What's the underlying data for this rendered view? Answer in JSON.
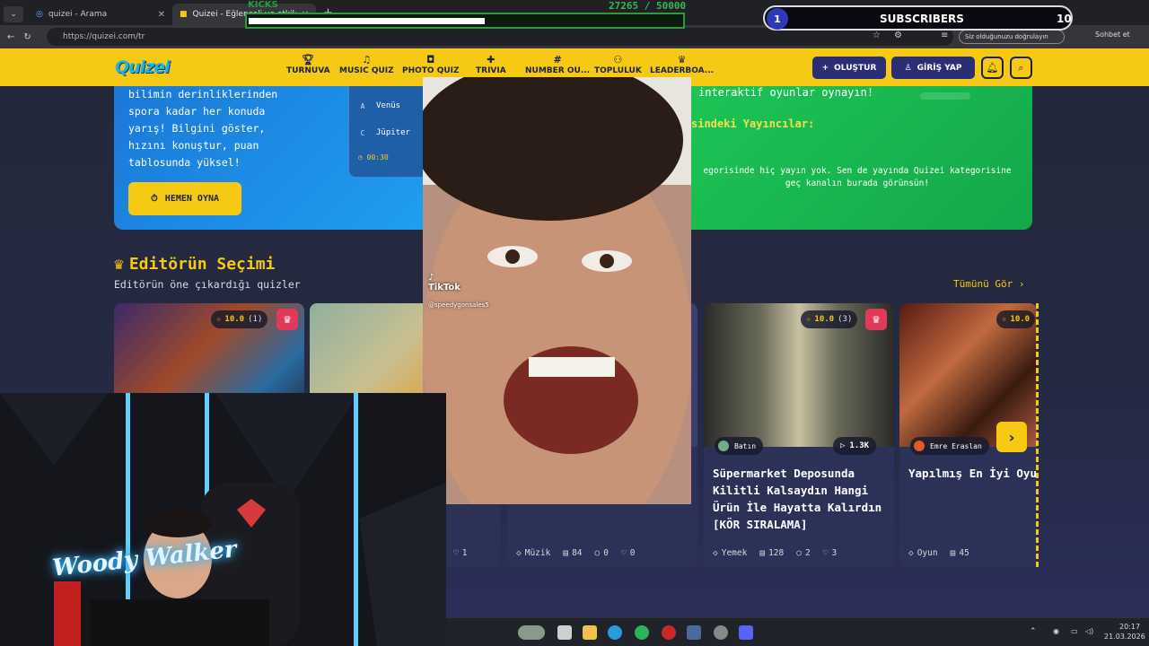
{
  "browser": {
    "tabs": [
      {
        "title": "quizei - Arama",
        "active": false
      },
      {
        "title": "Quizei - Eğlenceli ve etkileşimli qu...",
        "active": true
      }
    ],
    "url": "https://quizei.com/tr",
    "sync_label": "Siz olduğunuzu doğrulayın",
    "chat_label": "Sohbet et"
  },
  "header": {
    "logo": "Quizei",
    "nav": [
      {
        "label": "TURNUVA",
        "icon": "trophy-icon"
      },
      {
        "label": "MUSIC QUIZ",
        "icon": "music-note-icon"
      },
      {
        "label": "PHOTO QUIZ",
        "icon": "camera-icon"
      },
      {
        "label": "TRIVIA",
        "icon": "gamepad-icon"
      },
      {
        "label": "NUMBER OU...",
        "icon": "hashtag-icon"
      },
      {
        "label": "TOPLULUK",
        "icon": "users-icon"
      },
      {
        "label": "LEADERBOA...",
        "icon": "medal-icon"
      }
    ],
    "create_label": "OLUŞTUR",
    "login_label": "GİRİŞ YAP"
  },
  "hero": {
    "left_lines": [
      "bilimin derinliklerinden",
      "spora kadar her konuda",
      "yarış! Bilgini göster,",
      "hızını konuştur, puan",
      "tablosunda yüksel!"
    ],
    "play_button": "HEMEN OYNA",
    "quiz_card": {
      "options": [
        {
          "letter": "A",
          "text": "Venüs"
        },
        {
          "letter": "C",
          "text": "Jüpiter"
        }
      ],
      "timer": "00:30"
    },
    "right_line1": "interaktif oyunlar oynayın!",
    "right_heading": "sindeki Yayıncılar:",
    "right_line2": "egorisinde hiç yayın yok. Sen de yayında Quizei kategorisine",
    "right_line3": "geç kanalın burada görünsün!"
  },
  "editors_choice": {
    "title": "Editörün Seçimi",
    "subtitle": "Editörün öne çıkardığı quizler",
    "see_all": "Tümünü Gör ›",
    "cards": [
      {
        "rating": "10.0",
        "count": "(1)",
        "foot": []
      },
      {
        "rating": "",
        "count": "",
        "foot": []
      },
      {
        "foot_like": "1"
      },
      {
        "category": "Müzik",
        "questions": "84",
        "comments": "0",
        "likes": "0"
      },
      {
        "rating": "10.0",
        "count": "(3)",
        "author": "Batın",
        "plays": "1.3K",
        "title": "Süpermarket Deposunda Kilitli Kalsaydın Hangi Ürün İle Hayatta Kalırdın [KÖR SIRALAMA]",
        "category": "Yemek",
        "questions": "128",
        "comments": "2",
        "likes": "3"
      },
      {
        "rating": "10.0",
        "author": "Emre Eraslan",
        "title": "Yapılmış En İyi Oyun İntrosu Hangisi ?",
        "category": "Oyun",
        "questions": "45"
      }
    ]
  },
  "overlays": {
    "kicks_label": "KICKS",
    "kicks_count": "27265 / 50000",
    "kicks_progress": 0.545,
    "subs_count": "1",
    "subs_label": "SUBSCRIBERS",
    "subs_goal": "10",
    "tiktok_brand": "TikTok",
    "tiktok_handle": "@speedygonsales5",
    "streamer_name": "Woody Walker"
  },
  "taskbar": {
    "time": "20:17",
    "date": "21.03.2026"
  },
  "colors": {
    "accent": "#f6c915",
    "nav_btn": "#2a2e74",
    "hero_blue": "#1b78d8",
    "hero_green": "#1cc455"
  }
}
